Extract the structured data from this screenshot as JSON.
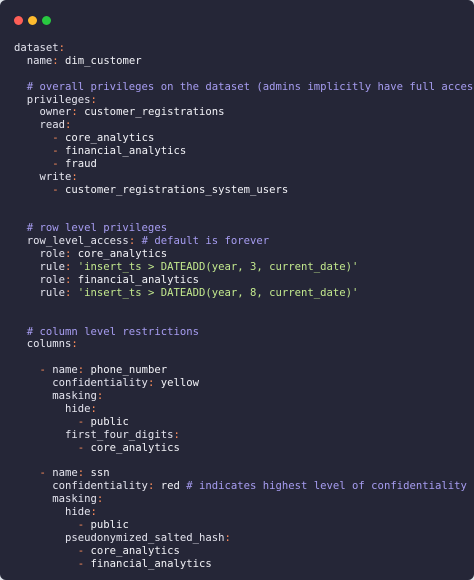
{
  "window": {
    "controls": [
      "close",
      "minimize",
      "zoom"
    ]
  },
  "code_lines": [
    [
      {
        "t": "k",
        "v": "dataset"
      },
      {
        "t": "p",
        "v": ":"
      }
    ],
    [
      {
        "t": "k",
        "v": "  name"
      },
      {
        "t": "p",
        "v": ":"
      },
      {
        "t": "v",
        "v": " dim_customer"
      }
    ],
    [],
    [
      {
        "t": "c",
        "v": "  # overall privileges on the dataset (admins implicitly have full access)"
      }
    ],
    [
      {
        "t": "k",
        "v": "  privileges"
      },
      {
        "t": "p",
        "v": ":"
      }
    ],
    [
      {
        "t": "k",
        "v": "    owner"
      },
      {
        "t": "p",
        "v": ":"
      },
      {
        "t": "v",
        "v": " customer_registrations"
      }
    ],
    [
      {
        "t": "k",
        "v": "    read"
      },
      {
        "t": "p",
        "v": ":"
      }
    ],
    [
      {
        "t": "p",
        "v": "      -"
      },
      {
        "t": "v",
        "v": " core_analytics"
      }
    ],
    [
      {
        "t": "p",
        "v": "      -"
      },
      {
        "t": "v",
        "v": " financial_analytics"
      }
    ],
    [
      {
        "t": "p",
        "v": "      -"
      },
      {
        "t": "v",
        "v": " fraud"
      }
    ],
    [
      {
        "t": "k",
        "v": "    write"
      },
      {
        "t": "p",
        "v": ":"
      }
    ],
    [
      {
        "t": "p",
        "v": "      -"
      },
      {
        "t": "v",
        "v": " customer_registrations_system_users"
      }
    ],
    [],
    [],
    [
      {
        "t": "c",
        "v": "  # row level privileges"
      }
    ],
    [
      {
        "t": "k",
        "v": "  row_level_access"
      },
      {
        "t": "p",
        "v": ":"
      },
      {
        "t": "c",
        "v": " # default is forever"
      }
    ],
    [
      {
        "t": "k",
        "v": "    role"
      },
      {
        "t": "p",
        "v": ":"
      },
      {
        "t": "v",
        "v": " core_analytics"
      }
    ],
    [
      {
        "t": "k",
        "v": "    rule"
      },
      {
        "t": "p",
        "v": ":"
      },
      {
        "t": "s",
        "v": " 'insert_ts > DATEADD(year, 3, current_date)'"
      }
    ],
    [
      {
        "t": "k",
        "v": "    role"
      },
      {
        "t": "p",
        "v": ":"
      },
      {
        "t": "v",
        "v": " financial_analytics"
      }
    ],
    [
      {
        "t": "k",
        "v": "    rule"
      },
      {
        "t": "p",
        "v": ":"
      },
      {
        "t": "s",
        "v": " 'insert_ts > DATEADD(year, 8, current_date)'"
      }
    ],
    [],
    [],
    [
      {
        "t": "c",
        "v": "  # column level restrictions"
      }
    ],
    [
      {
        "t": "k",
        "v": "  columns"
      },
      {
        "t": "p",
        "v": ":"
      }
    ],
    [],
    [
      {
        "t": "p",
        "v": "    -"
      },
      {
        "t": "k",
        "v": " name"
      },
      {
        "t": "p",
        "v": ":"
      },
      {
        "t": "v",
        "v": " phone_number"
      }
    ],
    [
      {
        "t": "k",
        "v": "      confidentiality"
      },
      {
        "t": "p",
        "v": ":"
      },
      {
        "t": "v",
        "v": " yellow"
      }
    ],
    [
      {
        "t": "k",
        "v": "      masking"
      },
      {
        "t": "p",
        "v": ":"
      }
    ],
    [
      {
        "t": "k",
        "v": "        hide"
      },
      {
        "t": "p",
        "v": ":"
      }
    ],
    [
      {
        "t": "p",
        "v": "          -"
      },
      {
        "t": "v",
        "v": " public"
      }
    ],
    [
      {
        "t": "k",
        "v": "        first_four_digits"
      },
      {
        "t": "p",
        "v": ":"
      }
    ],
    [
      {
        "t": "p",
        "v": "          -"
      },
      {
        "t": "v",
        "v": " core_analytics"
      }
    ],
    [],
    [
      {
        "t": "p",
        "v": "    -"
      },
      {
        "t": "k",
        "v": " name"
      },
      {
        "t": "p",
        "v": ":"
      },
      {
        "t": "v",
        "v": " ssn"
      }
    ],
    [
      {
        "t": "k",
        "v": "      confidentiality"
      },
      {
        "t": "p",
        "v": ":"
      },
      {
        "t": "v",
        "v": " red"
      },
      {
        "t": "c",
        "v": " # indicates highest level of confidentiality"
      }
    ],
    [
      {
        "t": "k",
        "v": "      masking"
      },
      {
        "t": "p",
        "v": ":"
      }
    ],
    [
      {
        "t": "k",
        "v": "        hide"
      },
      {
        "t": "p",
        "v": ":"
      }
    ],
    [
      {
        "t": "p",
        "v": "          -"
      },
      {
        "t": "v",
        "v": " public"
      }
    ],
    [
      {
        "t": "k",
        "v": "        pseudonymized_salted_hash"
      },
      {
        "t": "p",
        "v": ":"
      }
    ],
    [
      {
        "t": "p",
        "v": "          -"
      },
      {
        "t": "v",
        "v": " core_analytics"
      }
    ],
    [
      {
        "t": "p",
        "v": "          -"
      },
      {
        "t": "v",
        "v": " financial_analytics"
      }
    ]
  ]
}
